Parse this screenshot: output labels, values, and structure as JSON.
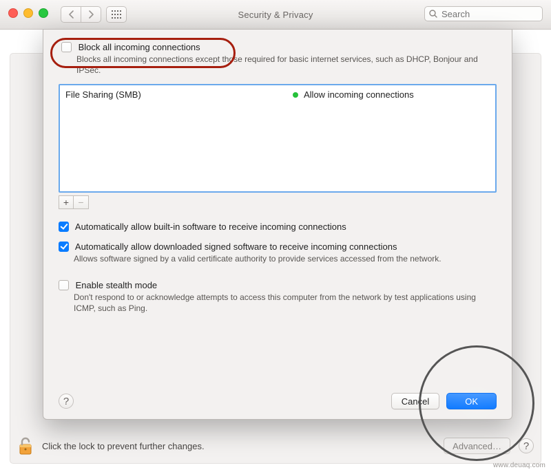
{
  "window": {
    "title": "Security & Privacy",
    "search_placeholder": "Search"
  },
  "sheet": {
    "block_all": {
      "label": "Block all incoming connections",
      "sub": "Blocks all incoming connections except those required for basic internet services, such as DHCP, Bonjour and IPSec."
    },
    "list": {
      "apps": [
        {
          "name": "File Sharing (SMB)",
          "status": "Allow incoming connections"
        }
      ]
    },
    "add_label": "+",
    "remove_label": "−",
    "auto_builtin": {
      "label": "Automatically allow built-in software to receive incoming connections"
    },
    "auto_signed": {
      "label": "Automatically allow downloaded signed software to receive incoming connections",
      "sub": "Allows software signed by a valid certificate authority to provide services accessed from the network."
    },
    "stealth": {
      "label": "Enable stealth mode",
      "sub": "Don't respond to or acknowledge attempts to access this computer from the network by test applications using ICMP, such as Ping."
    },
    "help_label": "?",
    "cancel": "Cancel",
    "ok": "OK"
  },
  "footer": {
    "lock_hint": "Click the lock to prevent further changes.",
    "advanced": "Advanced…",
    "help_label": "?"
  },
  "watermark": "www.deuaq.com"
}
